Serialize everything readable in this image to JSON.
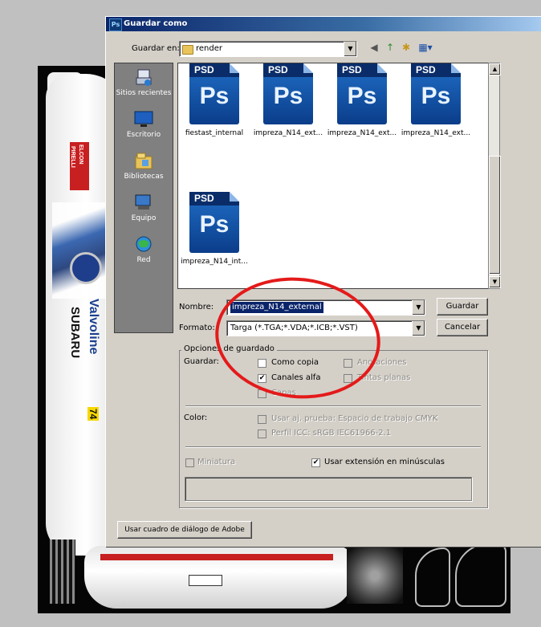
{
  "dialog": {
    "title": "Guardar como",
    "app_icon_text": "Ps"
  },
  "save_in": {
    "label": "Guardar en:",
    "value": "render",
    "toolbar_icons": [
      "back-icon",
      "up-folder-icon",
      "new-folder-icon",
      "view-menu-icon"
    ]
  },
  "places": [
    {
      "label": "Sitios recientes",
      "icon": "recent-places-icon"
    },
    {
      "label": "Escritorio",
      "icon": "desktop-icon"
    },
    {
      "label": "Bibliotecas",
      "icon": "libraries-icon"
    },
    {
      "label": "Equipo",
      "icon": "computer-icon"
    },
    {
      "label": "Red",
      "icon": "network-icon"
    }
  ],
  "files": [
    {
      "name": "fiestast_internal",
      "badge": "PSD",
      "glyph": "Ps"
    },
    {
      "name": "impreza_N14_ext...",
      "badge": "PSD",
      "glyph": "Ps"
    },
    {
      "name": "impreza_N14_ext...",
      "badge": "PSD",
      "glyph": "Ps"
    },
    {
      "name": "impreza_N14_ext...",
      "badge": "PSD",
      "glyph": "Ps"
    },
    {
      "name": "impreza_N14_int...",
      "badge": "PSD",
      "glyph": "Ps"
    }
  ],
  "filename": {
    "label": "Nombre:",
    "value": "impreza_N14_external"
  },
  "format": {
    "label": "Formato:",
    "value": "Targa (*.TGA;*.VDA;*.ICB;*.VST)"
  },
  "buttons": {
    "save": "Guardar",
    "cancel": "Cancelar",
    "adobe_dialog": "Usar cuadro de diálogo de Adobe"
  },
  "options": {
    "legend": "Opciones de guardado",
    "save_label": "Guardar:",
    "as_copy": {
      "label": "Como copia",
      "checked": false,
      "enabled": true
    },
    "annotations": {
      "label": "Anotaciones",
      "checked": false,
      "enabled": false
    },
    "alpha_channels": {
      "label": "Canales alfa",
      "checked": true,
      "enabled": true
    },
    "spot_colors": {
      "label": "Tintas planas",
      "checked": false,
      "enabled": false
    },
    "layers": {
      "label": "Capas",
      "checked": false,
      "enabled": false
    },
    "color_label": "Color:",
    "proof": {
      "label": "Usar aj. prueba: Espacio de trabajo CMYK",
      "checked": false,
      "enabled": false
    },
    "icc": {
      "label": "Perfil ICC: sRGB IEC61966-2.1",
      "checked": false,
      "enabled": false
    },
    "thumbnail": {
      "label": "Miniatura",
      "checked": false,
      "enabled": false
    },
    "lowercase_ext": {
      "label": "Usar extensión en minúsculas",
      "checked": true,
      "enabled": true
    }
  },
  "background": {
    "texts": [
      "Valvoline",
      "SUBARU",
      "74",
      "PIRELLI",
      "ELCON"
    ]
  },
  "annotation": {
    "color": "#e41a1a"
  }
}
